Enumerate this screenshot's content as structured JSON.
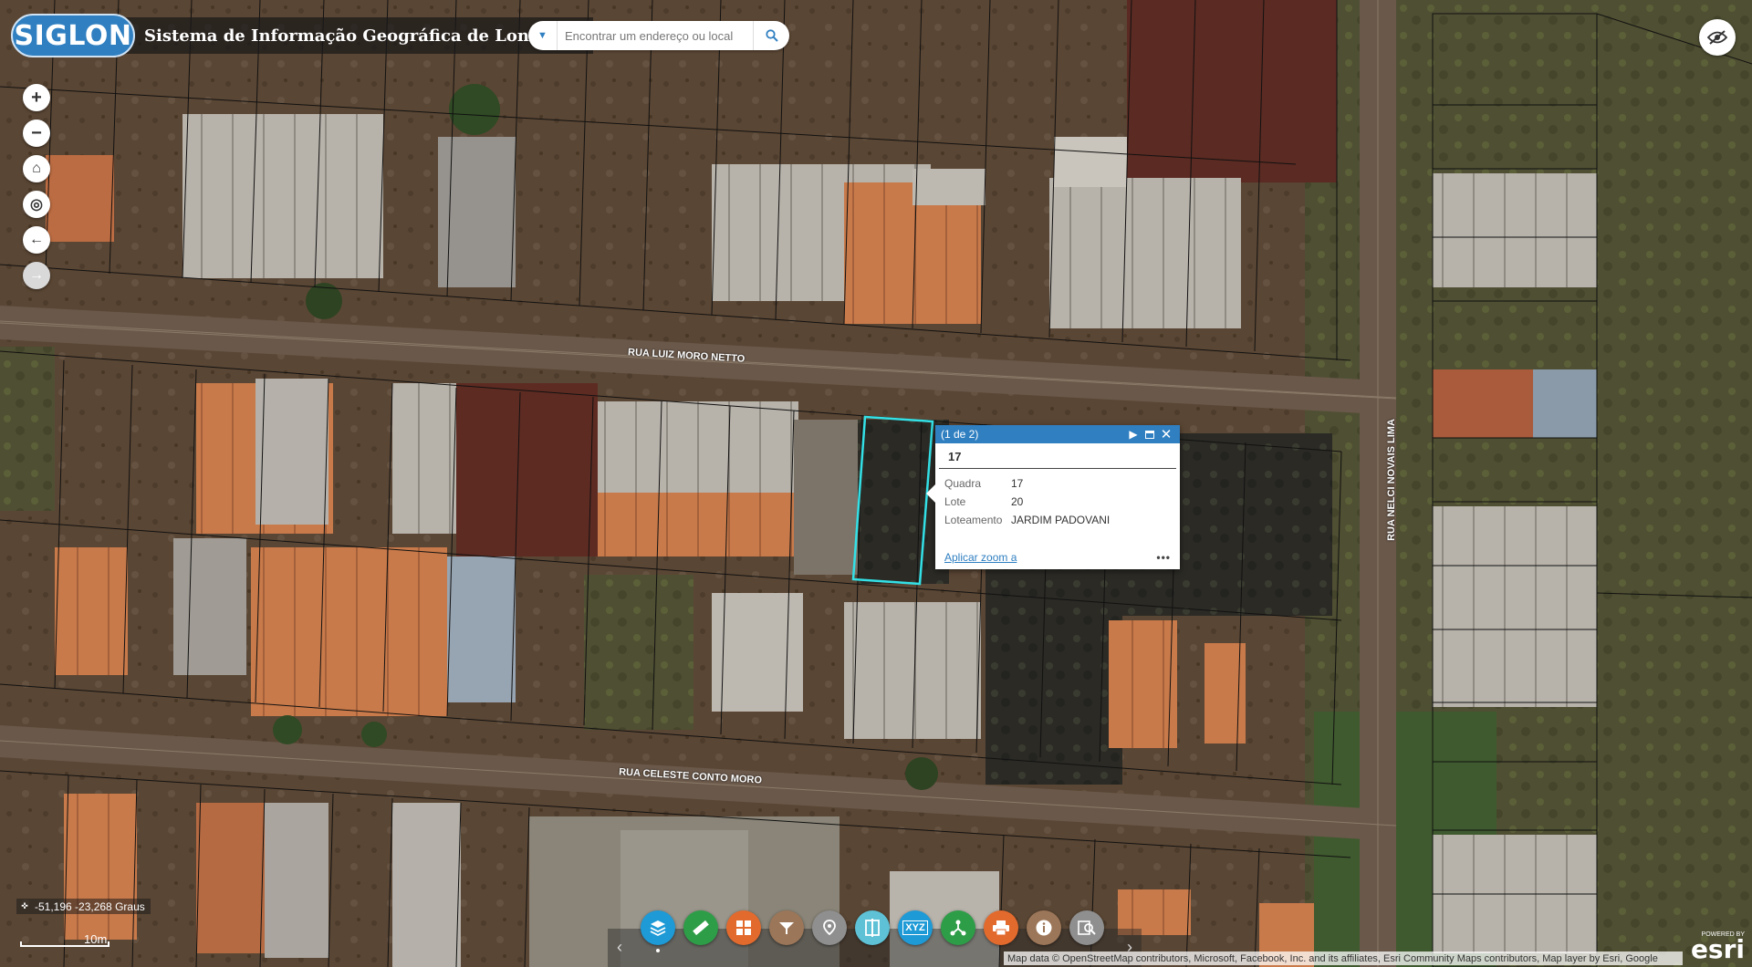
{
  "header": {
    "logo_text": "SIGLON",
    "title": "Sistema de Informação Geográfica de Londrina"
  },
  "search": {
    "placeholder": "Encontrar um endereço ou local"
  },
  "map": {
    "streets": [
      "RUA LUIZ MORO NETTO",
      "RUA CELESTE CONTO MORO",
      "RUA NELCI NOVAIS LIMA"
    ]
  },
  "zoom_controls": [
    {
      "name": "zoom-in",
      "glyph": "+"
    },
    {
      "name": "zoom-out",
      "glyph": "−"
    },
    {
      "name": "home",
      "glyph": "⌂"
    },
    {
      "name": "locate",
      "glyph": "◎"
    },
    {
      "name": "previous-extent",
      "glyph": "←"
    },
    {
      "name": "next-extent",
      "glyph": "→"
    }
  ],
  "popup": {
    "count": "(1 de 2)",
    "title": "17",
    "fields": [
      {
        "label": "Quadra",
        "value": "17"
      },
      {
        "label": "Lote",
        "value": "20"
      },
      {
        "label": "Loteamento",
        "value": "JARDIM PADOVANI"
      }
    ],
    "zoom_link": "Aplicar zoom a",
    "more": "•••",
    "accent": "#2f7fc1"
  },
  "coords": "-51,196 -23,268 Graus",
  "scale_label": "10m",
  "toolbar": {
    "tools": [
      {
        "name": "layers-icon",
        "color": "#1e9ad6"
      },
      {
        "name": "measure-icon",
        "color": "#2e9d48"
      },
      {
        "name": "basemap-gallery-icon",
        "color": "#e36a2d"
      },
      {
        "name": "filter-icon",
        "color": "#9c7658"
      },
      {
        "name": "location-icon",
        "color": "#8f8f8f"
      },
      {
        "name": "swipe-icon",
        "color": "#5ec1d6"
      },
      {
        "name": "xyz-coordinate-icon",
        "color": "#1e9ad6"
      },
      {
        "name": "share-icon",
        "color": "#2e9d48"
      },
      {
        "name": "print-icon",
        "color": "#e36a2d"
      },
      {
        "name": "info-icon",
        "color": "#9c7658"
      },
      {
        "name": "query-icon",
        "color": "#8f8f8f"
      }
    ],
    "xyz_label": "XYZ"
  },
  "attribution": "Map data © OpenStreetMap contributors, Microsoft, Facebook, Inc. and its affiliates, Esri Community Maps contributors, Map layer by Esri, Google",
  "esri": {
    "powered": "POWERED BY",
    "name": "esri"
  }
}
